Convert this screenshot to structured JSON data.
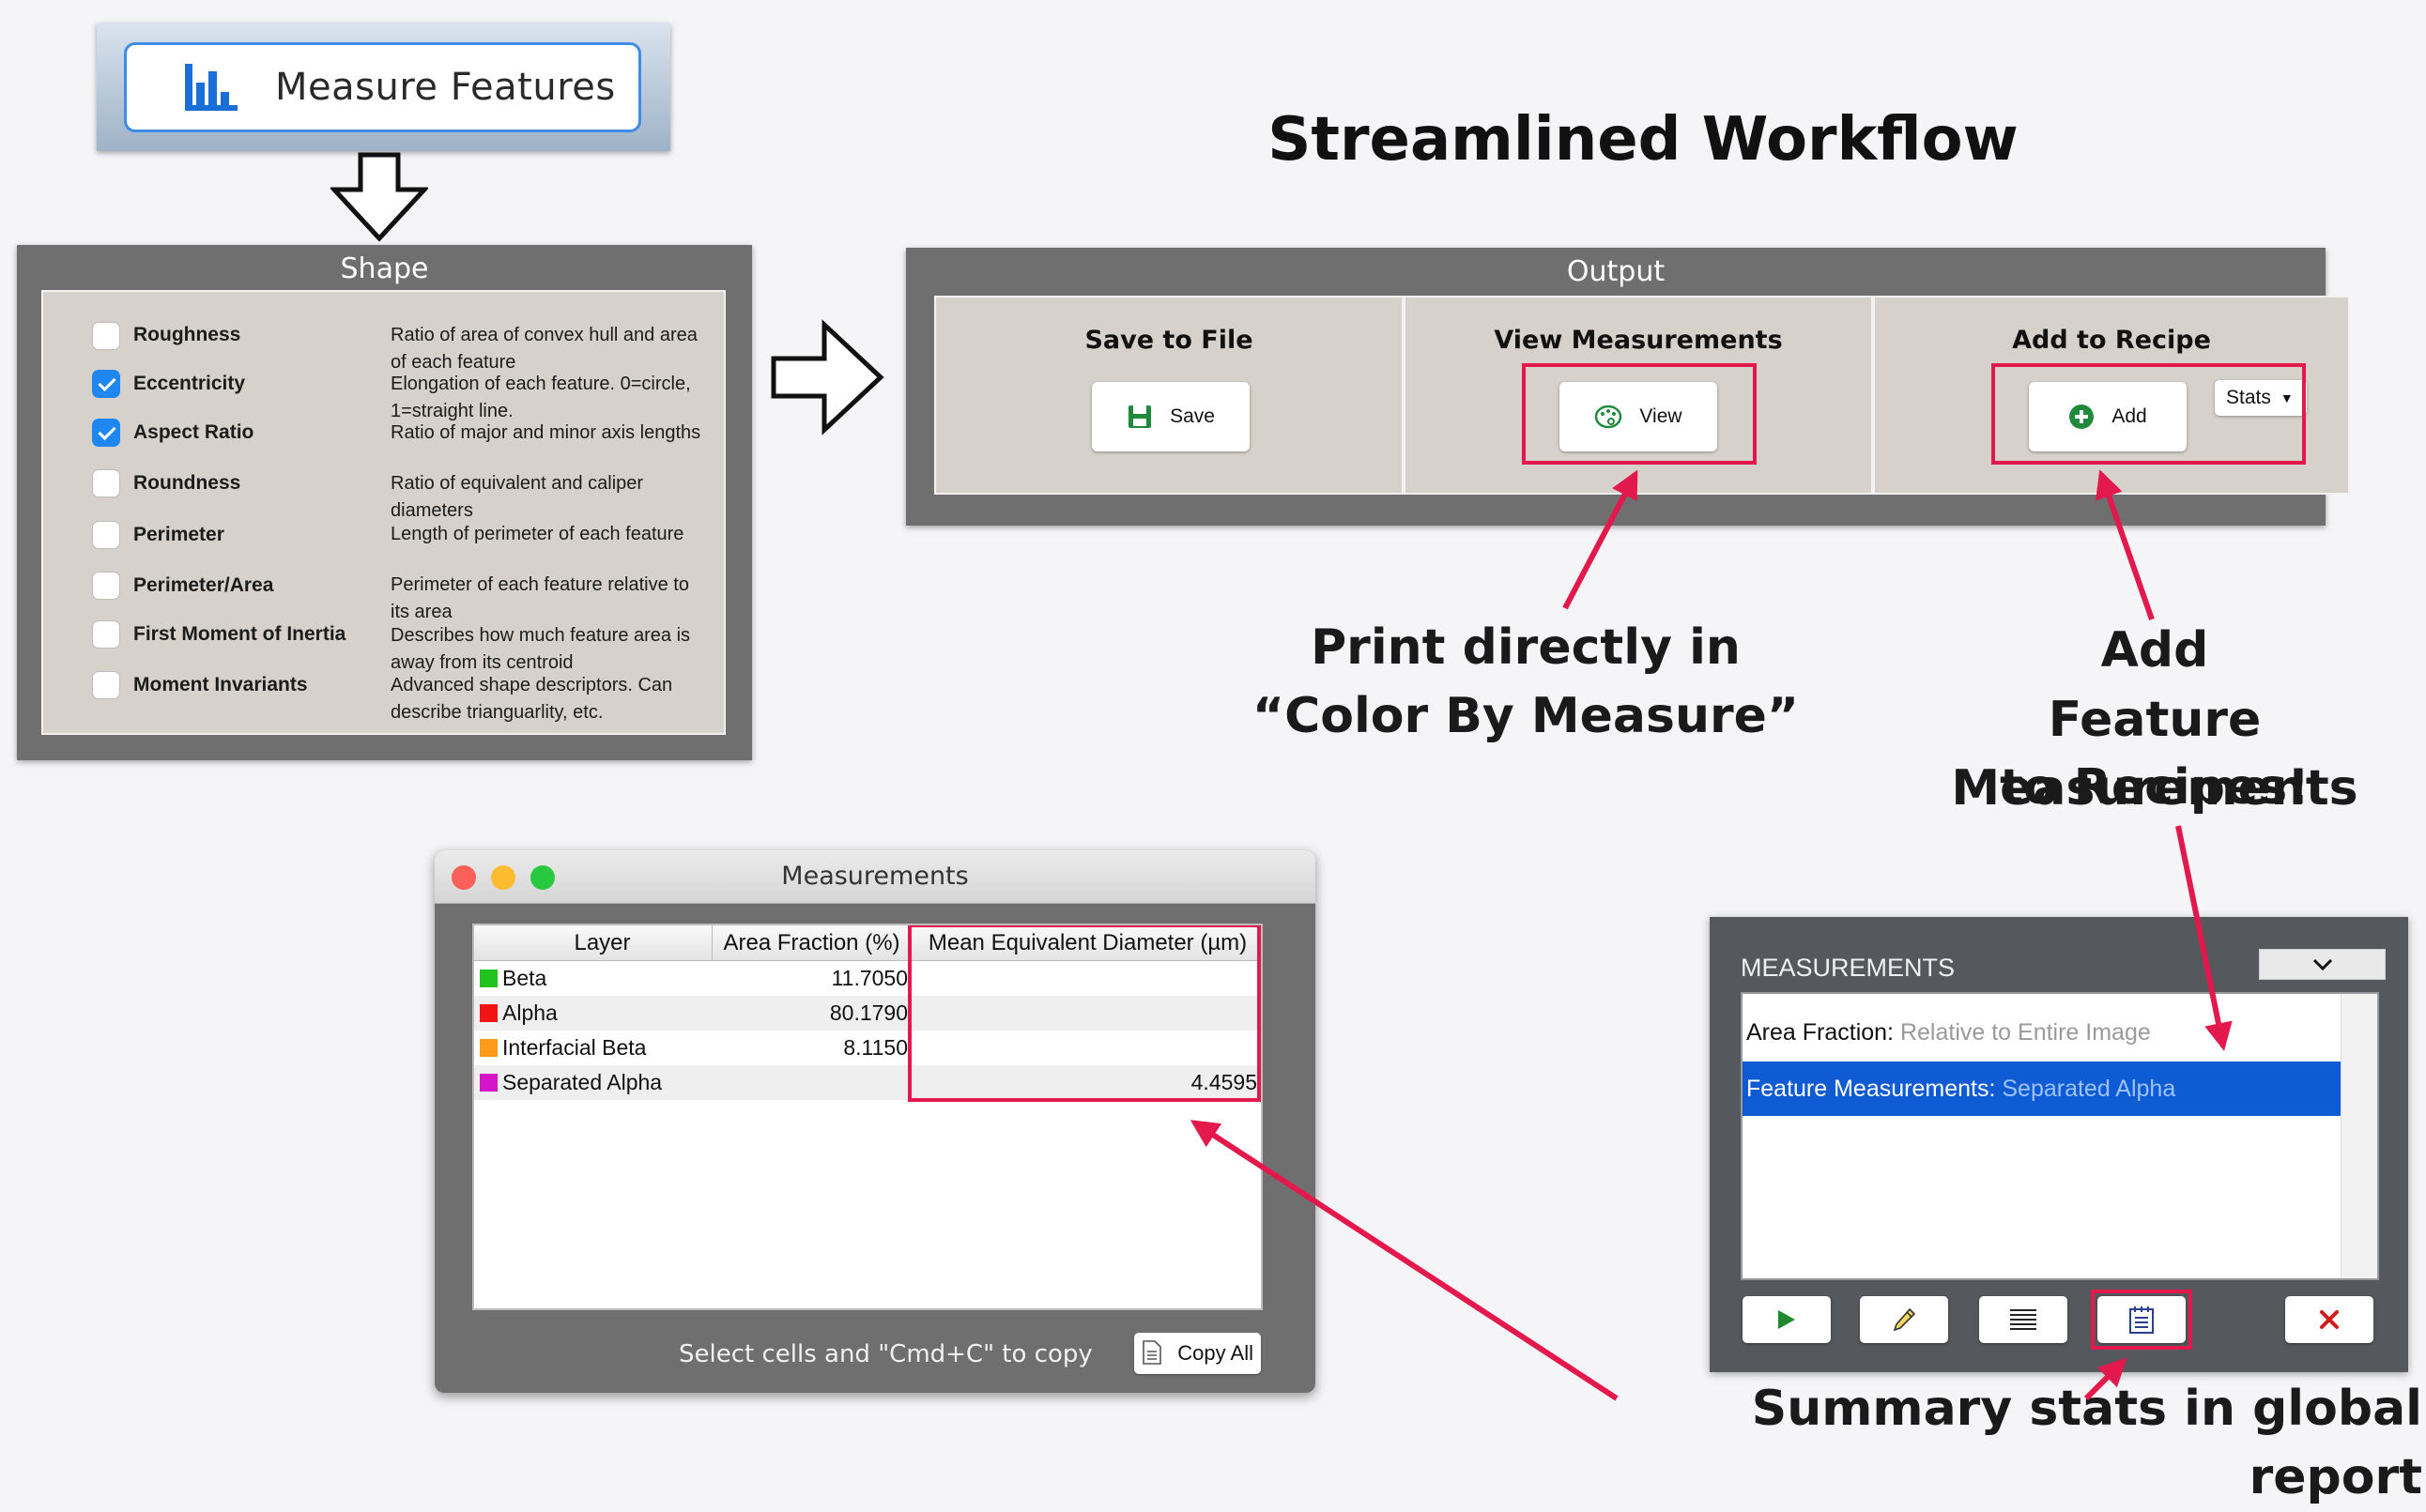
{
  "measure_features": {
    "label": "Measure Features",
    "icon": "bar-chart-icon"
  },
  "workflow_title": "Streamlined Workflow",
  "shape": {
    "title": "Shape",
    "items": [
      {
        "label": "Roughness",
        "checked": false,
        "desc": "Ratio of area of convex hull and area of each feature"
      },
      {
        "label": "Eccentricity",
        "checked": true,
        "desc": "Elongation of each feature. 0=circle, 1=straight line."
      },
      {
        "label": "Aspect Ratio",
        "checked": true,
        "desc": "Ratio of major and minor axis lengths"
      },
      {
        "label": "Roundness",
        "checked": false,
        "desc": "Ratio of equivalent and caliper diameters"
      },
      {
        "label": "Perimeter",
        "checked": false,
        "desc": "Length of perimeter of each feature"
      },
      {
        "label": "Perimeter/Area",
        "checked": false,
        "desc": "Perimeter of each feature relative to its area"
      },
      {
        "label": "First Moment of Inertia",
        "checked": false,
        "desc": "Describes how much feature area is away from its centroid"
      },
      {
        "label": "Moment Invariants",
        "checked": false,
        "desc": "Advanced shape descriptors. Can describe trianguarlity, etc."
      }
    ]
  },
  "output": {
    "title": "Output",
    "save": {
      "heading": "Save to File",
      "button": "Save",
      "icon": "floppy-disk-icon"
    },
    "view": {
      "heading": "View Measurements",
      "button": "View",
      "icon": "palette-icon"
    },
    "recipe": {
      "heading": "Add to Recipe",
      "button": "Add",
      "icon": "plus-circle-icon",
      "stats": "Stats"
    }
  },
  "annotations": {
    "print": "Print directly in “Color By Measure”",
    "add_line1": "Add",
    "add_line2": "Feature Measurements",
    "add_line3": "to Recipes!",
    "summary": "Summary stats in global report"
  },
  "measurements_window": {
    "title": "Measurements",
    "columns": [
      "Layer",
      "Area Fraction (%)",
      "Mean Equivalent Diameter (µm)"
    ],
    "rows": [
      {
        "layer": "Beta",
        "color": "#22c21f",
        "area": "11.7050",
        "diameter": ""
      },
      {
        "layer": "Alpha",
        "color": "#f01414",
        "area": "80.1790",
        "diameter": ""
      },
      {
        "layer": "Interfacial Beta",
        "color": "#ff9a1a",
        "area": "8.1150",
        "diameter": ""
      },
      {
        "layer": "Separated Alpha",
        "color": "#d414c8",
        "area": "",
        "diameter": "4.4595"
      }
    ],
    "hint": "Select cells and \"Cmd+C\" to copy",
    "copy_button": "Copy All"
  },
  "measurements_panel": {
    "title": "MEASUREMENTS",
    "items": [
      {
        "key": "Area Fraction:",
        "value": "Relative to Entire Image",
        "selected": false
      },
      {
        "key": "Feature Measurements:",
        "value": "Separated Alpha",
        "selected": true
      }
    ],
    "toolbar": [
      "play-icon",
      "pencil-icon",
      "list-icon",
      "report-icon",
      "delete-icon"
    ]
  },
  "colors": {
    "highlight": "#e3184d",
    "selection": "#0f5bd4",
    "accent": "#1e87f0"
  }
}
